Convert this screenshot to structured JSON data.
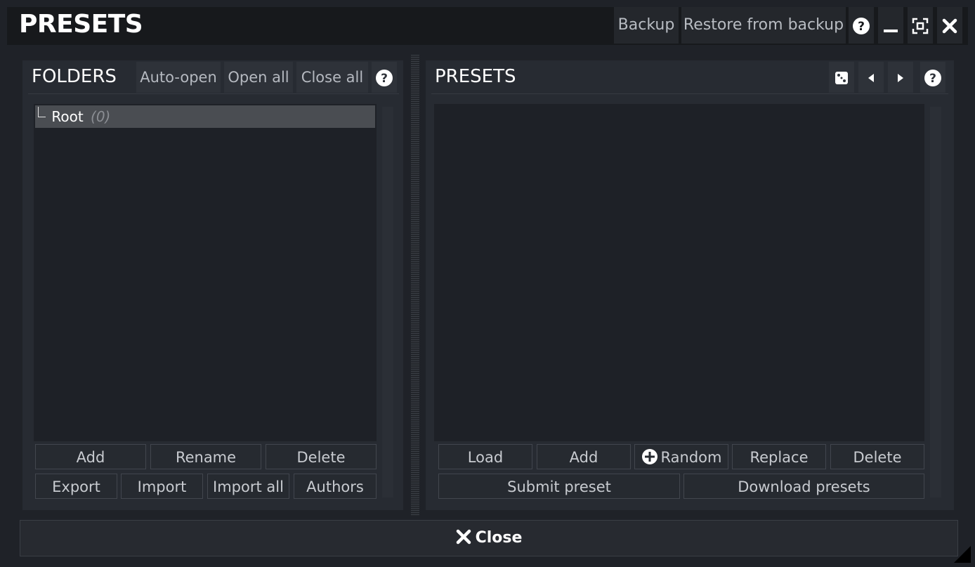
{
  "window": {
    "title": "PRESETS",
    "backup_label": "Backup",
    "restore_label": "Restore from backup",
    "help_icon": "help-icon",
    "minimize_icon": "minimize-icon",
    "fullscreen_icon": "fullscreen-icon",
    "close_icon": "close-icon"
  },
  "folders": {
    "title": "FOLDERS",
    "auto_open_label": "Auto-open",
    "open_all_label": "Open all",
    "close_all_label": "Close all",
    "tree": [
      {
        "label": "Root",
        "count": "(0)",
        "selected": true
      }
    ],
    "buttons_row1": [
      "Add",
      "Rename",
      "Delete"
    ],
    "buttons_row2": [
      "Export",
      "Import",
      "Import all",
      "Authors"
    ]
  },
  "presets": {
    "title": "PRESETS",
    "icons": [
      "dice-icon",
      "prev-arrow-icon",
      "next-arrow-icon",
      "help-icon"
    ],
    "buttons_row1": [
      "Load",
      "Add",
      "Random",
      "Replace",
      "Delete"
    ],
    "random_icon": "plus-circle-icon",
    "buttons_row2": [
      "Submit preset",
      "Download presets"
    ]
  },
  "footer": {
    "close_label": "Close",
    "close_icon": "close-icon"
  },
  "colors": {
    "background": "#1f2228",
    "panel": "#272b32",
    "titlebar": "#17191c",
    "selection": "#4a4d52"
  }
}
